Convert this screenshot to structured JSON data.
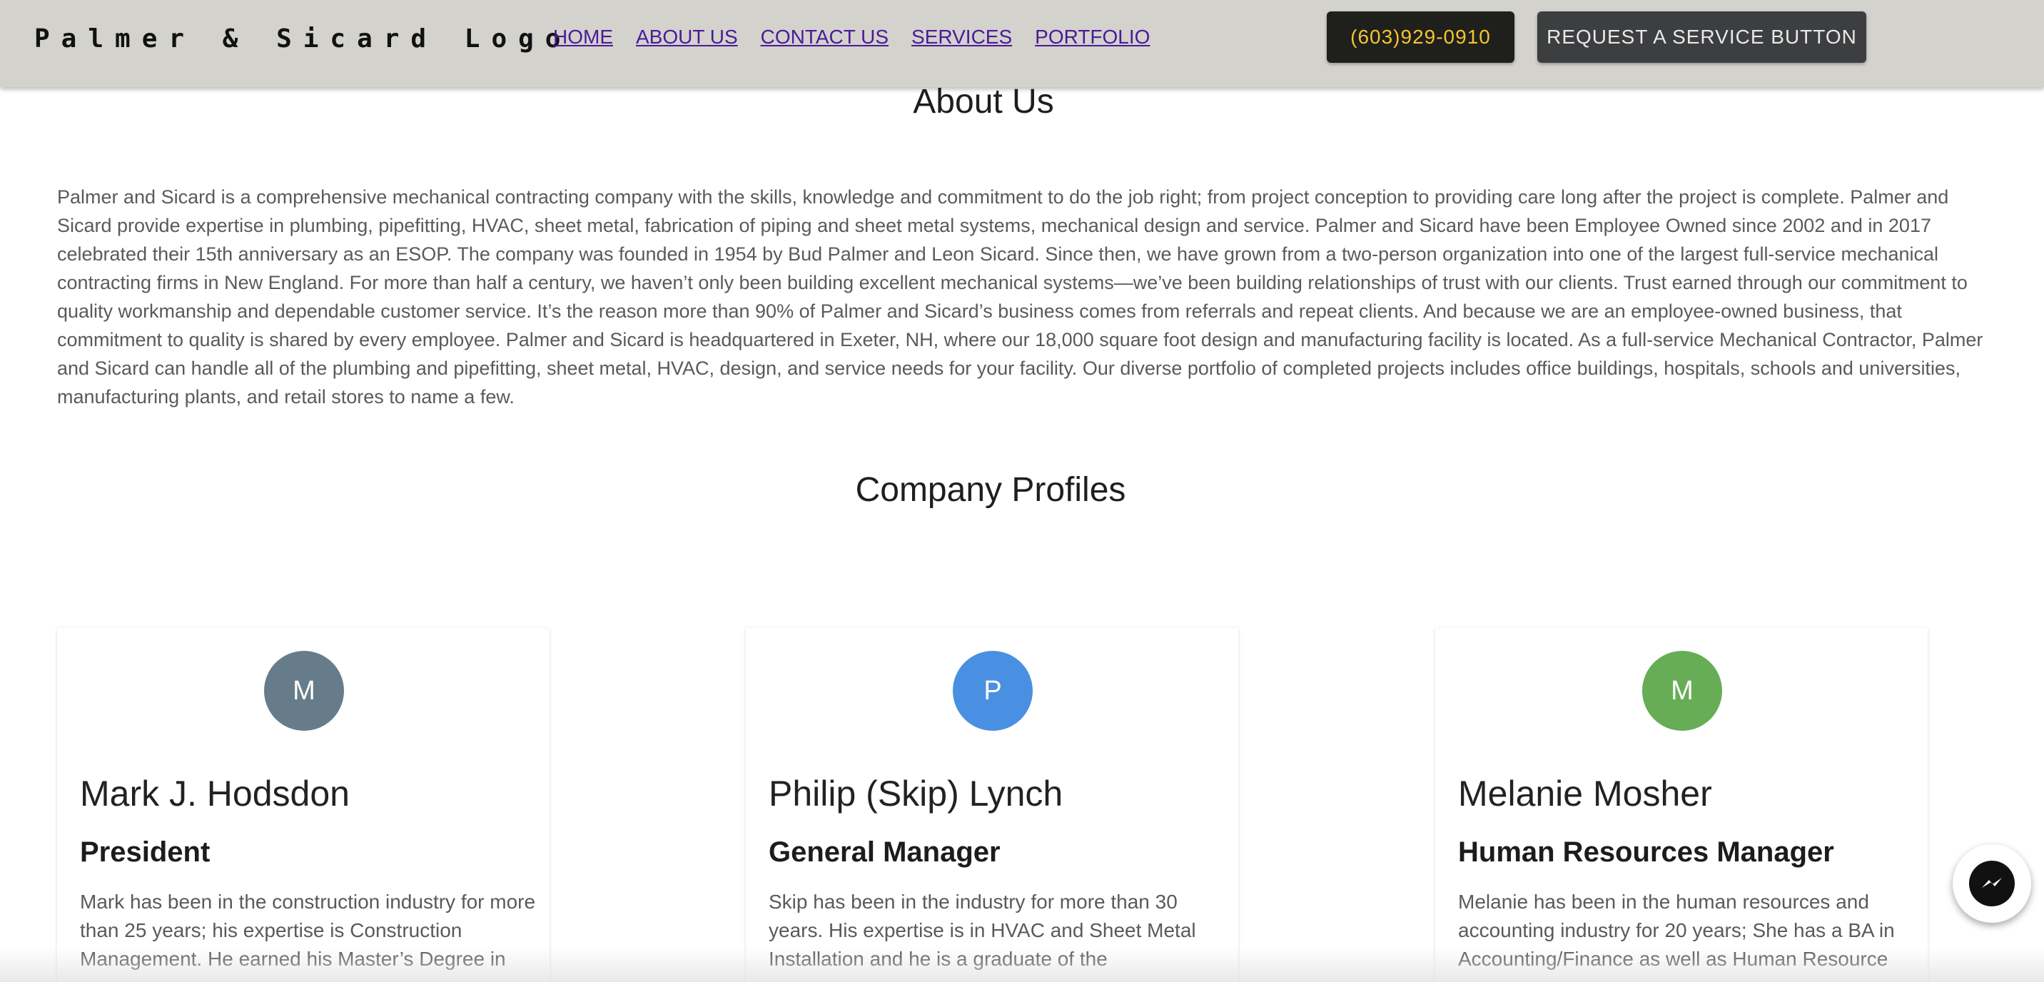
{
  "header": {
    "logo": "Palmer & Sicard Logo",
    "nav": [
      {
        "label": "HOME"
      },
      {
        "label": "ABOUT US"
      },
      {
        "label": "CONTACT US"
      },
      {
        "label": "SERVICES"
      },
      {
        "label": "PORTFOLIO"
      }
    ],
    "phone": "(603)929-0910",
    "request_button": "REQUEST A SERVICE BUTTON"
  },
  "about": {
    "title": "About Us",
    "text": "Palmer and Sicard is a comprehensive mechanical contracting company with the skills, knowledge and commitment to do the job right; from project conception to providing care long after the project is complete. Palmer and Sicard provide expertise in plumbing, pipefitting, HVAC, sheet metal, fabrication of piping and sheet metal systems, mechanical design and service. Palmer and Sicard have been Employee Owned since 2002 and in 2017 celebrated their 15th anniversary as an ESOP. The company was founded in 1954 by Bud Palmer and Leon Sicard. Since then, we have grown from a two-person organization into one of the largest full-service mechanical contracting firms in New England. For more than half a century, we haven’t only been building excellent mechanical systems—we’ve been building relationships of trust with our clients. Trust earned through our commitment to quality workmanship and dependable customer service. It’s the reason more than 90% of Palmer and Sicard’s business comes from referrals and repeat clients. And because we are an employee-owned business, that commitment to quality is shared by every employee. Palmer and Sicard is headquartered in Exeter, NH, where our 18,000 square foot design and manufacturing facility is located. As a full-service Mechanical Contractor, Palmer and Sicard can handle all of the plumbing and pipefitting, sheet metal, HVAC, design, and service needs for your facility. Our diverse portfolio of completed projects includes office buildings, hospitals, schools and universities, manufacturing plants, and retail stores to name a few."
  },
  "profiles": {
    "title": "Company Profiles",
    "cards": [
      {
        "initial": "M",
        "avatar_color": "#667c8a",
        "name": "Mark J. Hodsdon",
        "role": "President",
        "bio": "Mark has been in the construction industry for more than 25 years; his expertise is Construction Management. He earned his Master’s Degree in"
      },
      {
        "initial": "P",
        "avatar_color": "#4a90e2",
        "name": "Philip (Skip) Lynch",
        "role": "General Manager",
        "bio": "Skip has been in the industry for more than 30 years. His expertise is in HVAC and Sheet Metal Installation and he is a graduate of the"
      },
      {
        "initial": "M",
        "avatar_color": "#66ad55",
        "name": "Melanie Mosher",
        "role": "Human Resources Manager",
        "bio": "Melanie has been in the human resources and accounting industry for 20 years; She has a BA in Accounting/Finance as well as Human Resource"
      }
    ]
  },
  "messenger": {
    "icon": "messenger-icon"
  }
}
